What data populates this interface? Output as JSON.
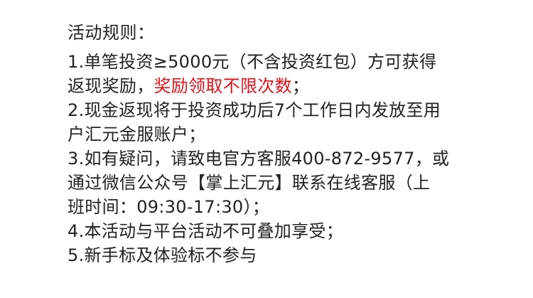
{
  "title": "活动规则：",
  "colors": {
    "text": "#222222",
    "highlight": "#e0121b"
  },
  "rules": [
    {
      "line1": "1.单笔投资≥5000元（不含投资红包）方可获得",
      "line2_pre": "返现奖励，",
      "line2_highlight": "奖励领取不限次数",
      "line2_post": "；"
    },
    {
      "line1": "2.现金返现将于投资成功后7个工作日内发放至用",
      "line2": "户汇元金服账户；"
    },
    {
      "line1": "3.如有疑问，请致电官方客服400-872-9577，或",
      "line2": "通过微信公众号【掌上汇元】联系在线客服（上",
      "line3": "班时间：09:30-17:30）；"
    },
    {
      "line1": "4.本活动与平台活动不可叠加享受；"
    },
    {
      "line1": "5.新手标及体验标不参与"
    }
  ]
}
